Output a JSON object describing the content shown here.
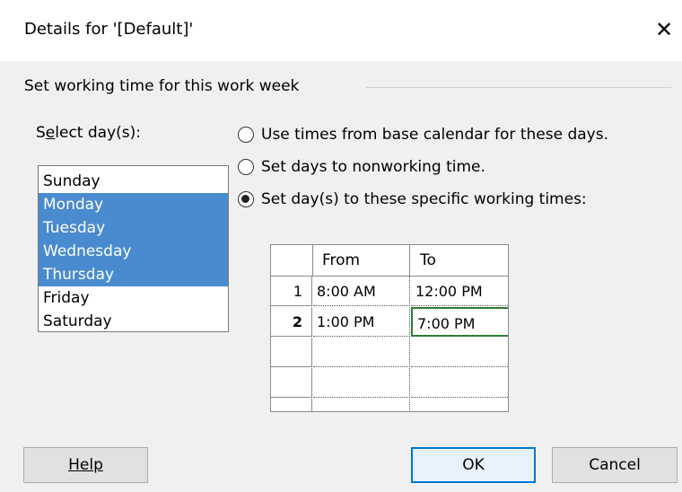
{
  "window": {
    "title": "Details for '[Default]'",
    "close_label": "✕"
  },
  "group": {
    "label": "Set working time for this work week"
  },
  "days": {
    "label": "Select day(s):",
    "items": [
      {
        "label": "Sunday",
        "selected": false
      },
      {
        "label": "Monday",
        "selected": true
      },
      {
        "label": "Tuesday",
        "selected": true
      },
      {
        "label": "Wednesday",
        "selected": true
      },
      {
        "label": "Thursday",
        "selected": true
      },
      {
        "label": "Friday",
        "selected": false
      },
      {
        "label": "Saturday",
        "selected": false
      }
    ]
  },
  "options": [
    {
      "label": "Use times from base calendar for these days.",
      "checked": false
    },
    {
      "label": "Set days to nonworking time.",
      "checked": false
    },
    {
      "label": "Set day(s) to these specific working times:",
      "checked": true
    }
  ],
  "grid": {
    "headers": {
      "from": "From",
      "to": "To"
    },
    "rows": [
      {
        "num": "1",
        "from": "8:00 AM",
        "to": "12:00 PM"
      },
      {
        "num": "2",
        "from": "1:00 PM",
        "to": "7:00 PM"
      },
      {
        "num": "",
        "from": "",
        "to": ""
      },
      {
        "num": "",
        "from": "",
        "to": ""
      },
      {
        "num": "",
        "from": "",
        "to": ""
      }
    ]
  },
  "buttons": {
    "help": "Help",
    "ok": "OK",
    "cancel": "Cancel"
  },
  "colors": {
    "selection": "#4a8bd0",
    "active_cell": "#2e7d32",
    "default_button_border": "#0078d7"
  }
}
